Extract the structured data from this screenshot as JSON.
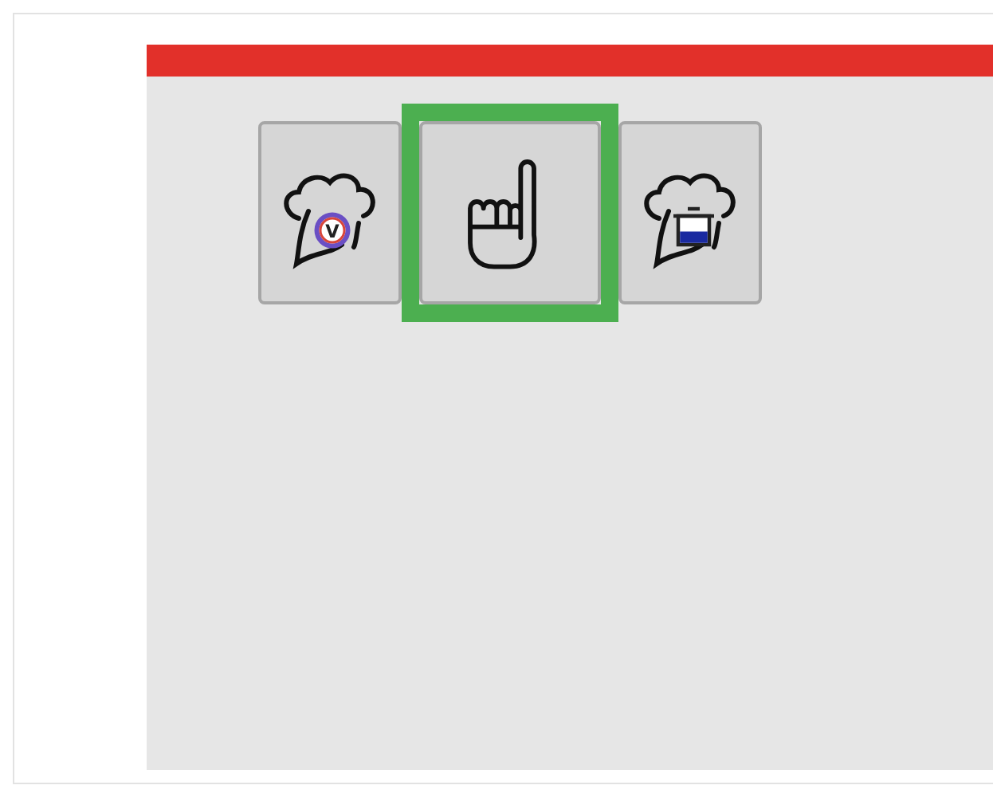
{
  "toolbar": {
    "buttons": [
      {
        "kind": "chef-badge",
        "badge": "V",
        "selected": false
      },
      {
        "kind": "hand",
        "selected": true
      },
      {
        "kind": "chef-pot",
        "selected": false
      }
    ]
  }
}
